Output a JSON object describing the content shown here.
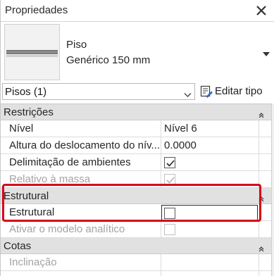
{
  "window": {
    "title": "Propriedades"
  },
  "type_selector": {
    "family": "Piso",
    "type": "Genérico 150 mm"
  },
  "instance": {
    "selection": "Pisos (1)",
    "edit_type_label": "Editar tipo"
  },
  "groups": [
    {
      "label": "Restrições",
      "rows": [
        {
          "name": "Nível",
          "value": "Nível 6"
        },
        {
          "name": "Altura do deslocamento do nív...",
          "value": "0.0000"
        },
        {
          "name": "Delimitação de ambientes",
          "checked": true
        },
        {
          "name": "Relativo à massa",
          "checked": true,
          "disabled": true
        }
      ]
    },
    {
      "label": "Estrutural",
      "rows": [
        {
          "name": "Estrutural",
          "checked": false,
          "active": true
        },
        {
          "name": "Ativar o modelo analítico",
          "checked": false,
          "disabled": true
        }
      ]
    },
    {
      "label": "Cotas",
      "rows": [
        {
          "name": "Inclinação",
          "value": "",
          "disabled": true
        }
      ]
    }
  ],
  "colors": {
    "highlight": "#d9001b",
    "group_bg": "#e1e1e1",
    "disabled_text": "#a3a3a3"
  },
  "icons": {
    "close": "close-icon",
    "type_dropdown": "triangle-down-icon",
    "instance_dropdown": "chevron-down-icon",
    "edit_type": "edit-type-icon",
    "collapse": "collapse-chevrons-icon",
    "check": "checkmark-icon"
  }
}
